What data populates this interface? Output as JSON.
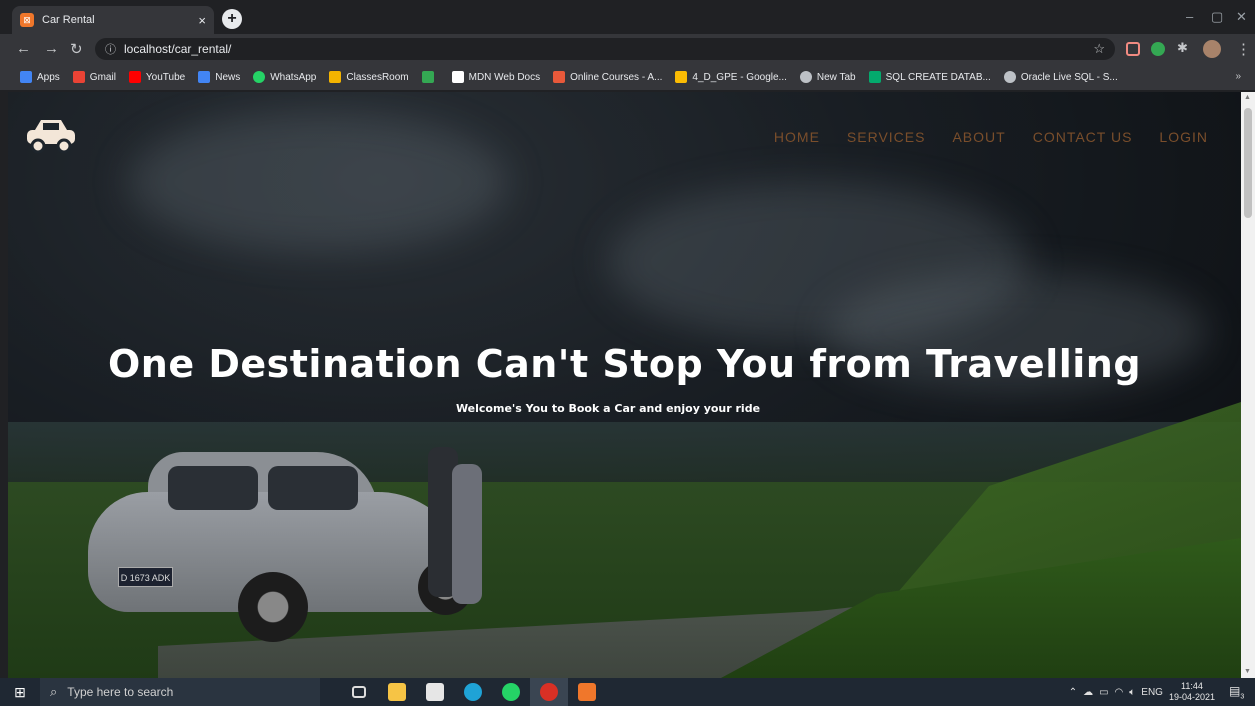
{
  "browser": {
    "tab_title": "Car Rental",
    "tab_close": "×",
    "new_tab": "+",
    "url": "localhost/car_rental/",
    "bookmarks": [
      {
        "label": "Apps",
        "color": "#4285f4"
      },
      {
        "label": "Gmail",
        "color": "#ea4335"
      },
      {
        "label": "YouTube",
        "color": "#ff0000"
      },
      {
        "label": "News",
        "color": "#4285f4"
      },
      {
        "label": "WhatsApp",
        "color": "#25d366"
      },
      {
        "label": "ClassesRoom",
        "color": "#f4b400"
      },
      {
        "label": "",
        "color": "#34a853"
      },
      {
        "label": "MDN Web Docs",
        "color": "#ffffff"
      },
      {
        "label": "Online Courses - A...",
        "color": "#e8593a"
      },
      {
        "label": "4_D_GPE - Google...",
        "color": "#fbbc04"
      },
      {
        "label": "New Tab",
        "color": "#bdc1c6"
      },
      {
        "label": "SQL CREATE DATAB...",
        "color": "#04aa6d"
      },
      {
        "label": "Oracle Live SQL - S...",
        "color": "#bdc1c6"
      }
    ],
    "bookmarks_more": "»"
  },
  "site": {
    "nav": [
      "HOME",
      "SERVICES",
      "ABOUT",
      "CONTACT US",
      "LOGIN"
    ],
    "hero_title": "One Destination Can't Stop You from Travelling",
    "hero_subtitle": "Welcome's You to Book a Car and enjoy your ride",
    "car_plate": "D 1673 ADK",
    "accent_color": "#7a4e2b"
  },
  "taskbar": {
    "search_placeholder": "Type here to search",
    "language": "ENG",
    "time": "11:44",
    "date": "19-04-2021",
    "notification_count": "3"
  }
}
